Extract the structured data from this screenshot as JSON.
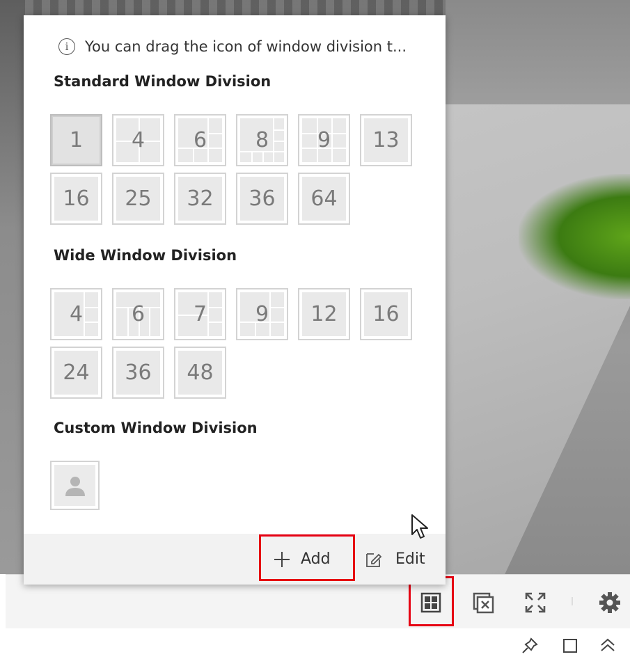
{
  "hint_text": "You can drag the icon of window division t...",
  "standard": {
    "title": "Standard Window Division",
    "tiles": [
      "1",
      "4",
      "6",
      "8",
      "9",
      "13",
      "16",
      "25",
      "32",
      "36",
      "64"
    ]
  },
  "wide": {
    "title": "Wide Window Division",
    "tiles": [
      "4",
      "6",
      "7",
      "9",
      "12",
      "16",
      "24",
      "36",
      "48"
    ]
  },
  "custom": {
    "title": "Custom Window Division"
  },
  "footer": {
    "add_label": "Add",
    "edit_label": "Edit"
  },
  "toolbar_icons": [
    "window-division-icon",
    "close-all-windows-icon",
    "fullscreen-icon",
    "settings-icon"
  ],
  "status_icons": [
    "pin-icon",
    "maximize-icon",
    "collapse-up-icon"
  ],
  "colors": {
    "highlight": "#e60012",
    "tile_bg": "#e9e9e9"
  }
}
